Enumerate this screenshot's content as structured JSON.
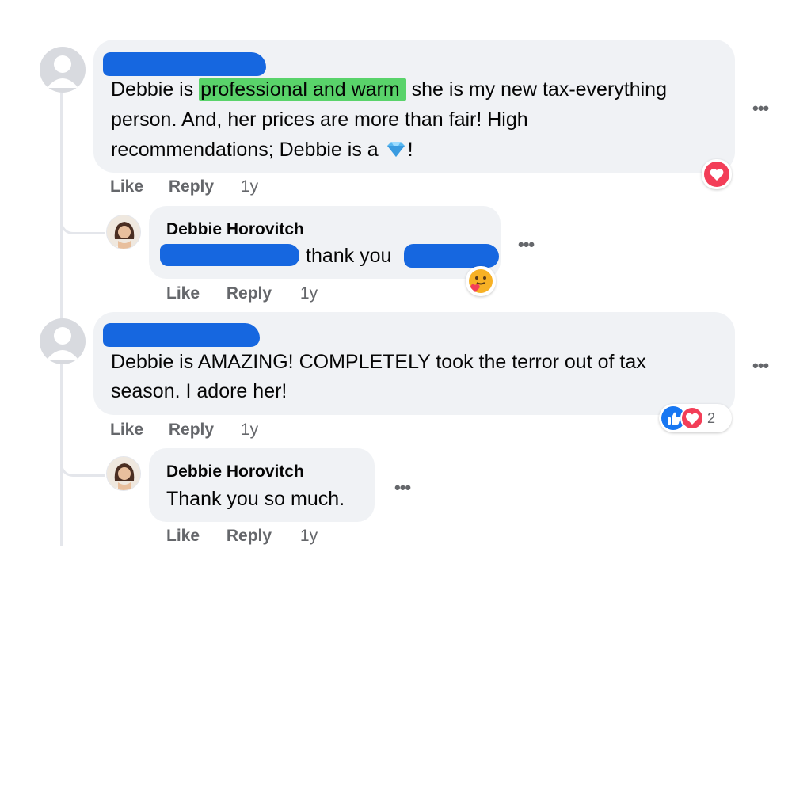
{
  "comments": [
    {
      "text_before": "Debbie is ",
      "highlight": "professional and warm",
      "text_after": " she is my new tax-everything",
      "line2": "person. And, her prices are more than fair! High",
      "line3_before": "recommendations; Debbie is a ",
      "line3_after": "!",
      "action_like": "Like",
      "action_reply": "Reply",
      "time": "1y",
      "more": "•••",
      "reaction_icon": "heart-icon",
      "reply": {
        "author": "Debbie Horovitch",
        "text": "thank you",
        "action_like": "Like",
        "action_reply": "Reply",
        "time": "1y",
        "more": "•••",
        "reaction_icon": "care-icon"
      }
    },
    {
      "line1": "Debbie is AMAZING! COMPLETELY took the terror out of tax",
      "line2": "season. I adore her!",
      "action_like": "Like",
      "action_reply": "Reply",
      "time": "1y",
      "more": "•••",
      "reaction_count": "2",
      "reaction_icons": [
        "like-icon",
        "heart-icon"
      ],
      "reply": {
        "author": "Debbie Horovitch",
        "text": "Thank you so much.",
        "action_like": "Like",
        "action_reply": "Reply",
        "time": "1y",
        "more": "•••"
      }
    }
  ],
  "colors": {
    "bubble": "#f0f2f5",
    "secondary_text": "#65676b",
    "redaction": "#1667e0",
    "highlight": "#59d36a",
    "like_blue": "#1877f2",
    "love_red": "#f33e58"
  }
}
